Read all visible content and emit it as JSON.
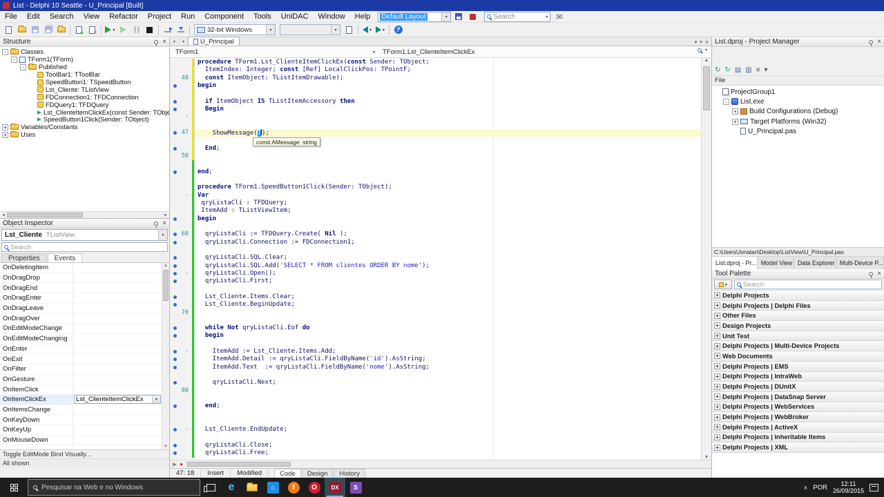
{
  "window": {
    "title": "List - Delphi 10 Seattle - U_Principal [Built]"
  },
  "menubar": {
    "menus": [
      "File",
      "Edit",
      "Search",
      "View",
      "Refactor",
      "Project",
      "Run",
      "Component",
      "Tools",
      "UniDAC",
      "Window",
      "Help"
    ],
    "layout_combo": "Default Layout",
    "search_placeholder": "Search"
  },
  "toolbar": {
    "buttons": [
      {
        "name": "new-items-button",
        "icon": "page"
      },
      {
        "name": "open-button",
        "icon": "folder"
      },
      {
        "name": "save-button",
        "icon": "floppy",
        "disabled": true
      },
      {
        "name": "save-all-button",
        "icon": "floppy2",
        "disabled": true
      },
      {
        "name": "open-project-button",
        "icon": "folder"
      },
      {
        "sep": true
      },
      {
        "name": "add-file-button",
        "icon": "page-plus"
      },
      {
        "name": "remove-file-button",
        "icon": "page-minus"
      },
      {
        "sep": true
      },
      {
        "name": "run-button",
        "icon": "play",
        "dropdown": true
      },
      {
        "name": "run-without-debugging-button",
        "icon": "play-o"
      },
      {
        "name": "pause-button",
        "icon": "pause",
        "disabled": true
      },
      {
        "name": "program-reset-button",
        "icon": "stop"
      },
      {
        "sep": true
      },
      {
        "name": "step-over-button",
        "icon": "step1"
      },
      {
        "name": "trace-into-button",
        "icon": "step2"
      },
      {
        "sep": true
      },
      {
        "name": "target-platform-combo",
        "icon": "monitor",
        "combo": "32-bit Windows",
        "width": 118
      },
      {
        "name": "build-config-combo",
        "combo": "",
        "width": 88,
        "disabled": true
      },
      {
        "name": "compile-button",
        "icon": "page",
        "icon2": "",
        "iconx": "",
        "icon3": "",
        "icon_final": "",
        "icon_real": ""
      },
      {
        "sep": true
      },
      {
        "name": "browse-back-button",
        "icon": "tri-l",
        "dropdown": true
      },
      {
        "name": "browse-forward-button",
        "icon": "tri-r",
        "dropdown": true
      },
      {
        "sep": true
      },
      {
        "name": "help-button",
        "icon": "help"
      }
    ]
  },
  "structure": {
    "title": "Structure",
    "nodes": [
      {
        "depth": 0,
        "expand": "minus",
        "icon": "folder",
        "label": "Classes"
      },
      {
        "depth": 1,
        "expand": "minus",
        "icon": "class",
        "label": "TForm1(TForm)"
      },
      {
        "depth": 2,
        "expand": "minus",
        "icon": "folder",
        "label": "Published"
      },
      {
        "depth": 3,
        "expand": "none",
        "icon": "component",
        "label": "ToolBar1: TToolBar"
      },
      {
        "depth": 3,
        "expand": "none",
        "icon": "component",
        "label": "SpeedButton1: TSpeedButton"
      },
      {
        "depth": 3,
        "expand": "none",
        "icon": "component",
        "label": "Lst_Cliente: TListView"
      },
      {
        "depth": 3,
        "expand": "none",
        "icon": "component",
        "label": "FDConnection1: TFDConnection"
      },
      {
        "depth": 3,
        "expand": "none",
        "icon": "component",
        "label": "FDQuery1: TFDQuery"
      },
      {
        "depth": 3,
        "expand": "none",
        "icon": "method",
        "label": "Lst_ClienteItemClickEx(const Sender: TObject; It"
      },
      {
        "depth": 3,
        "expand": "none",
        "icon": "method",
        "label": "SpeedButton1Click(Sender: TObject)"
      },
      {
        "depth": 0,
        "expand": "plus",
        "icon": "folder",
        "label": "Variables/Constants"
      },
      {
        "depth": 0,
        "expand": "plus",
        "icon": "folder",
        "label": "Uses"
      }
    ]
  },
  "object_inspector": {
    "title": "Object Inspector",
    "object_name": "Lst_Cliente",
    "object_type": "TListView",
    "search_placeholder": "Search",
    "tabs": [
      {
        "label": "Properties",
        "active": false
      },
      {
        "label": "Events",
        "active": true
      }
    ],
    "events": [
      {
        "name": "OnDeletingItem",
        "value": ""
      },
      {
        "name": "OnDragDrop",
        "value": ""
      },
      {
        "name": "OnDragEnd",
        "value": ""
      },
      {
        "name": "OnDragEnter",
        "value": ""
      },
      {
        "name": "OnDragLeave",
        "value": ""
      },
      {
        "name": "OnDragOver",
        "value": ""
      },
      {
        "name": "OnEditModeChange",
        "value": ""
      },
      {
        "name": "OnEditModeChanging",
        "value": ""
      },
      {
        "name": "OnEnter",
        "value": ""
      },
      {
        "name": "OnExit",
        "value": ""
      },
      {
        "name": "OnFilter",
        "value": ""
      },
      {
        "name": "OnGesture",
        "value": ""
      },
      {
        "name": "OnItemClick",
        "value": ""
      },
      {
        "name": "OnItemClickEx",
        "value": "Lst_ClienteItemClickEx",
        "selected": true
      },
      {
        "name": "OnItemsChange",
        "value": ""
      },
      {
        "name": "OnKeyDown",
        "value": ""
      },
      {
        "name": "OnKeyUp",
        "value": ""
      },
      {
        "name": "OnMouseDown",
        "value": ""
      }
    ],
    "hint": "Toggle EditMode Bind Visually...",
    "footer": "All shown"
  },
  "editor": {
    "tab": "U_Principal",
    "crumb1": "TForm1",
    "crumb2": "TForm1.Lst_ClienteItemClickEx",
    "tooltip": "const AMessage: string",
    "status": {
      "caret": "47: 18",
      "mode": "Insert",
      "state": "Modified"
    },
    "bottom_tabs": [
      {
        "label": "Code",
        "active": true
      },
      {
        "label": "Design",
        "active": false
      },
      {
        "label": "History",
        "active": false
      }
    ],
    "lines": [
      {
        "c": "y",
        "s": [
          [
            "k",
            "procedure"
          ],
          [
            "p",
            " TForm1.Lst_ClienteItemClickEx("
          ],
          [
            "k",
            "const"
          ],
          [
            "p",
            " Sender: TObject;"
          ]
        ]
      },
      {
        "c": "y",
        "s": [
          [
            "p",
            "  ItemIndex: Integer; "
          ],
          [
            "k",
            "const"
          ],
          [
            "p",
            " [Ref] LocalClickPos: TPointF;"
          ]
        ]
      },
      {
        "n": "40",
        "c": "y",
        "s": [
          [
            "p",
            "  "
          ],
          [
            "k",
            "const"
          ],
          [
            "p",
            " ItemObject: TListItemDrawable);"
          ]
        ]
      },
      {
        "d": 1,
        "c": "y",
        "s": [
          [
            "k",
            "begin"
          ]
        ]
      },
      {
        "c": "y",
        "s": []
      },
      {
        "d": 1,
        "c": "y",
        "s": [
          [
            "p",
            "  "
          ],
          [
            "k",
            "if"
          ],
          [
            "p",
            " ItemObject "
          ],
          [
            "k",
            "IS"
          ],
          [
            "p",
            " TListItemAccessory "
          ],
          [
            "k",
            "then"
          ]
        ]
      },
      {
        "d": 1,
        "c": "y",
        "s": [
          [
            "p",
            "  "
          ],
          [
            "k",
            "Begin"
          ]
        ]
      },
      {
        "m": 1,
        "c": "y",
        "s": []
      },
      {
        "c": "y",
        "s": []
      },
      {
        "n": "47",
        "d": 1,
        "cur": 1,
        "c": "y",
        "s": [
          [
            "p",
            "    ShowMessage("
          ],
          [
            "x",
            "T"
          ],
          [
            "p",
            ");"
          ]
        ]
      },
      {
        "c": "y",
        "s": []
      },
      {
        "d": 1,
        "c": "y",
        "s": [
          [
            "p",
            "  "
          ],
          [
            "k",
            "End"
          ],
          [
            "p",
            ";"
          ]
        ]
      },
      {
        "n": "50",
        "c": "y",
        "s": []
      },
      {
        "c": "g",
        "s": []
      },
      {
        "d": 1,
        "c": "g",
        "s": [
          [
            "k",
            "end"
          ],
          [
            "p",
            ";"
          ]
        ]
      },
      {
        "c": "g",
        "s": []
      },
      {
        "c": "g",
        "s": [
          [
            "k",
            "procedure"
          ],
          [
            "p",
            " TForm1.SpeedButton1Click(Sender: TObject);"
          ]
        ]
      },
      {
        "m": 1,
        "c": "g",
        "s": [
          [
            "k",
            "Var"
          ]
        ]
      },
      {
        "c": "g",
        "s": [
          [
            "p",
            " qryListaCli : TFDQuery;"
          ]
        ]
      },
      {
        "c": "g",
        "s": [
          [
            "p",
            " ItemAdd : TListViewItem;"
          ]
        ]
      },
      {
        "d": 1,
        "c": "g",
        "s": [
          [
            "k",
            "begin"
          ]
        ]
      },
      {
        "c": "g",
        "s": []
      },
      {
        "n": "60",
        "d": 1,
        "c": "g",
        "s": [
          [
            "p",
            "  qryListaCli := TFDQuery.Create( "
          ],
          [
            "k",
            "Nil"
          ],
          [
            "p",
            " );"
          ]
        ]
      },
      {
        "d": 1,
        "c": "g",
        "s": [
          [
            "p",
            "  qryListaCli.Connection := FDConnection1;"
          ]
        ]
      },
      {
        "c": "g",
        "s": []
      },
      {
        "d": 1,
        "c": "g",
        "s": [
          [
            "p",
            "  qryListaCli.SQL.Clear;"
          ]
        ]
      },
      {
        "d": 1,
        "c": "g",
        "s": [
          [
            "p",
            "  qryListaCli.SQL.Add("
          ],
          [
            "s",
            "'SELECT * FROM clientes ORDER BY nome'"
          ],
          [
            "p",
            ");"
          ]
        ]
      },
      {
        "m": 1,
        "d": 1,
        "c": "g",
        "s": [
          [
            "p",
            "  qryListaCli.Open();"
          ]
        ]
      },
      {
        "d": 1,
        "c": "g",
        "s": [
          [
            "p",
            "  qryListaCli.First;"
          ]
        ]
      },
      {
        "c": "g",
        "s": []
      },
      {
        "d": 1,
        "c": "g",
        "s": [
          [
            "p",
            "  Lst_Cliente.Items.Clear;"
          ]
        ]
      },
      {
        "d": 1,
        "c": "g",
        "s": [
          [
            "p",
            "  Lst_Cliente.BeginUpdate;"
          ]
        ]
      },
      {
        "n": "70",
        "c": "g",
        "s": []
      },
      {
        "c": "g",
        "s": []
      },
      {
        "d": 1,
        "c": "g",
        "s": [
          [
            "p",
            "  "
          ],
          [
            "k",
            "while"
          ],
          [
            "p",
            " "
          ],
          [
            "k",
            "Not"
          ],
          [
            "p",
            " qryListaCli.Eof "
          ],
          [
            "k",
            "do"
          ]
        ]
      },
      {
        "d": 1,
        "c": "g",
        "s": [
          [
            "p",
            "  "
          ],
          [
            "k",
            "begin"
          ]
        ]
      },
      {
        "c": "g",
        "s": []
      },
      {
        "m": 1,
        "d": 1,
        "c": "g",
        "s": [
          [
            "p",
            "    ItemAdd := Lst_Cliente.Items.Add;"
          ]
        ]
      },
      {
        "d": 1,
        "c": "g",
        "s": [
          [
            "p",
            "    ItemAdd.Detail := qryListaCli.FieldByName("
          ],
          [
            "s",
            "'id'"
          ],
          [
            "p",
            ").AsString;"
          ]
        ]
      },
      {
        "d": 1,
        "c": "g",
        "s": [
          [
            "p",
            "    ItemAdd.Text  := qryListaCli.FieldByName("
          ],
          [
            "s",
            "'nome'"
          ],
          [
            "p",
            ").AsString;"
          ]
        ]
      },
      {
        "c": "g",
        "s": []
      },
      {
        "d": 1,
        "c": "g",
        "s": [
          [
            "p",
            "    qryListaCli.Next;"
          ]
        ]
      },
      {
        "n": "80",
        "c": "g",
        "s": []
      },
      {
        "c": "g",
        "s": []
      },
      {
        "d": 1,
        "c": "g",
        "s": [
          [
            "p",
            "  "
          ],
          [
            "k",
            "end"
          ],
          [
            "p",
            ";"
          ]
        ]
      },
      {
        "c": "g",
        "s": []
      },
      {
        "c": "g",
        "s": []
      },
      {
        "m": 1,
        "d": 1,
        "c": "g",
        "s": [
          [
            "p",
            "  Lst_Cliente.EndUpdate;"
          ]
        ]
      },
      {
        "c": "g",
        "s": []
      },
      {
        "d": 1,
        "c": "g",
        "s": [
          [
            "p",
            "  qryListaCli.Close;"
          ]
        ]
      },
      {
        "d": 1,
        "c": "g",
        "s": [
          [
            "p",
            "  qryListaCli.Free;"
          ]
        ]
      }
    ]
  },
  "project_manager": {
    "title": "List.dproj - Project Manager",
    "toolbar": [
      {
        "name": "activate-button",
        "glyph": "↻",
        "color": "#1f8e4e"
      },
      {
        "name": "sync-button",
        "glyph": "↻",
        "color": "#2a9a8a"
      },
      {
        "name": "new-button",
        "glyph": "▤",
        "color": "#4a6a9a"
      },
      {
        "name": "remove-button",
        "glyph": "▥",
        "color": "#4a6a9a"
      },
      {
        "name": "view-list-button",
        "glyph": "≡",
        "color": "#555555"
      },
      {
        "name": "sort-menu-button",
        "glyph": "▾",
        "color": "#555555"
      }
    ],
    "file_header": "File",
    "nodes": [
      {
        "depth": 0,
        "expand": "none",
        "icon": "group",
        "label": "ProjectGroup1"
      },
      {
        "depth": 1,
        "expand": "minus",
        "icon": "app",
        "label": "List.exe"
      },
      {
        "depth": 2,
        "expand": "plus",
        "icon": "build",
        "label": "Build Configurations (Debug)"
      },
      {
        "depth": 2,
        "expand": "plus",
        "icon": "platform",
        "label": "Target Platforms (Win32)"
      },
      {
        "depth": 2,
        "expand": "none",
        "icon": "unit",
        "label": "U_Principal.pas"
      }
    ],
    "path": "C:\\Users\\Jonatan\\Desktop\\ListView\\U_Principal.pas",
    "tabs": [
      {
        "label": "List.dproj - Pr...",
        "active": true
      },
      {
        "label": "Model View",
        "active": false
      },
      {
        "label": "Data Explorer",
        "active": false
      },
      {
        "label": "Multi-Device P...",
        "active": false
      }
    ]
  },
  "tool_palette": {
    "title": "Tool Palette",
    "search_placeholder": "Search",
    "categories": [
      "Delphi Projects",
      "Delphi Projects | Delphi Files",
      "Other Files",
      "Design Projects",
      "Unit Test",
      "Delphi Projects | Multi-Device Projects",
      "Web Documents",
      "Delphi Projects | EMS",
      "Delphi Projects | IntraWeb",
      "Delphi Projects | DUnitX",
      "Delphi Projects | DataSnap Server",
      "Delphi Projects | WebServices",
      "Delphi Projects | WebBroker",
      "Delphi Projects | ActiveX",
      "Delphi Projects | Inheritable Items",
      "Delphi Projects | XML"
    ]
  },
  "taskbar": {
    "search_placeholder": "Pesquisar na Web e no Windows",
    "icons": [
      {
        "name": "microsoft-edge",
        "kind": "glyph",
        "glyph": "e",
        "color": "#45b6ea",
        "size": 16
      },
      {
        "name": "file-explorer",
        "kind": "folder"
      },
      {
        "name": "windows-store",
        "kind": "tile",
        "glyph": "⌂",
        "color": "#1f8fde"
      },
      {
        "name": "firefox",
        "kind": "circ",
        "glyph": "f",
        "color": "#f07c1a"
      },
      {
        "name": "opera",
        "kind": "circ",
        "glyph": "O",
        "color": "#cf1f2f"
      },
      {
        "name": "rad-studio",
        "kind": "tile",
        "glyph": "DX",
        "color": "#8a2030",
        "active": true
      },
      {
        "name": "capture-tool",
        "kind": "tile",
        "glyph": "S",
        "color": "#7d4fb0"
      }
    ],
    "tray_lang": "POR",
    "clock_time": "12:11",
    "clock_date": "26/09/2015"
  }
}
